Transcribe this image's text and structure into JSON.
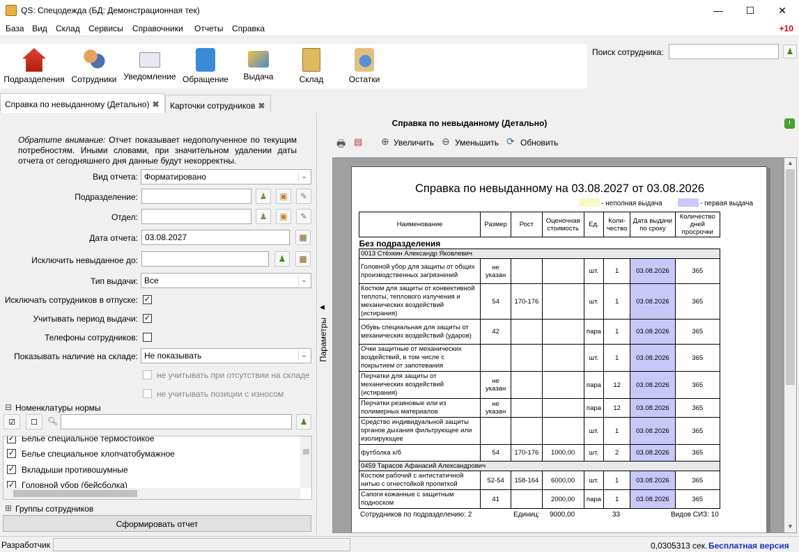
{
  "window": {
    "title": "QS: Спецодежда (БД: Демонстрационная тек)",
    "min": "—",
    "max": "☐",
    "close": "✕"
  },
  "menu": {
    "items": [
      "База",
      "Вид",
      "Склад",
      "Сервисы",
      "Справочники",
      "Отчеты",
      "Справка"
    ],
    "badge": "+10"
  },
  "toolbar": {
    "buttons": [
      "Подразделения",
      "Сотрудники",
      "Уведомление",
      "Обращение",
      "Выдача",
      "Склад",
      "Остатки"
    ]
  },
  "search": {
    "label": "Поиск сотрудника:",
    "value": ""
  },
  "tabs": [
    {
      "label": "Справка по невыданному (Детально)"
    },
    {
      "label": "Карточки сотрудников"
    }
  ],
  "params": {
    "note_em": "Обратите внимание:",
    "note": "Отчет показывает недополученное по текущим потребностям. Иными словами, при значительном удалении даты отчета от сегодняшнего дня данные будут некорректны.",
    "report_type_label": "Вид отчета:",
    "report_type_value": "Форматировано",
    "division_label": "Подразделение:",
    "division_value": "",
    "department_label": "Отдел:",
    "department_value": "",
    "report_date_label": "Дата отчета:",
    "report_date_value": "03.08.2027",
    "exclude_label": "Исключить невыданное до:",
    "exclude_value": "",
    "issue_type_label": "Тип выдачи:",
    "issue_type_value": "Все",
    "vacation_label": "Исключать сотрудников в отпуске:",
    "vacation_checked": "✓",
    "period_label": "Учитывать период выдачи:",
    "period_checked": "✓",
    "phones_label": "Телефоны сотрудников:",
    "phones_checked": "",
    "stock_label": "Показывать наличие на складе:",
    "stock_value": "Не показывать",
    "no_stock_label": "не учитывать при отсутствии на складе",
    "worn_label": "не учитывать позиции с износом",
    "nomenclature_header": "Номенклатуры нормы",
    "nomenclature_items": [
      "Белье специальное термостойкое",
      "Белье специальное хлопчатобумажное",
      "Вкладыши противошумные",
      "Головной убор (бейсболка)"
    ],
    "groups_header": "Группы сотрудников",
    "generate_button": "Сформировать отчет",
    "side_label": "Параметры"
  },
  "report": {
    "viewer_title": "Справка по невыданному (Детально)",
    "zoom_in": "Увеличить",
    "zoom_out": "Уменьшить",
    "refresh": "Обновить",
    "heading": "Справка по невыданному на 03.08.2027 от 03.08.2026",
    "legend_partial": "- неполная выдача",
    "legend_first": "- первая выдача",
    "columns": [
      "Наименование",
      "Размер",
      "Рост",
      "Оценочная стоимость",
      "Ед.",
      "Коли-чество",
      "Дата выдачи по сроку",
      "Количество дней просрочки"
    ],
    "group": "Без подразделения",
    "employees": [
      {
        "name": "0013  Стёхкин Александр Яковлевич",
        "rows": [
          [
            "Головной убор для защиты от общих производственных загрязнений",
            "не указан",
            "",
            "",
            "шт.",
            "1",
            "03.08.2026",
            "365"
          ],
          [
            "Костюм для защиты от конвективной теплоты, теплового излучения и механических воздействий (истирания)",
            "54",
            "170-176",
            "",
            "шт.",
            "1",
            "03.08.2026",
            "365"
          ],
          [
            "Обувь специальная для защиты от механических воздействий (ударов)",
            "42",
            "",
            "",
            "пара",
            "1",
            "03.08.2026",
            "365"
          ],
          [
            "Очки защитные от механических воздействий, в том числе с покрытием от запотевания",
            "",
            "",
            "",
            "шт.",
            "1",
            "03.08.2026",
            "365"
          ],
          [
            "Перчатки для защиты от механических воздействий (истирания)",
            "не указан",
            "",
            "",
            "пара",
            "12",
            "03.08.2026",
            "365"
          ],
          [
            "Перчатки резиновые или из полимерных материалов",
            "не указан",
            "",
            "",
            "пара",
            "12",
            "03.08.2026",
            "365"
          ],
          [
            "Средство индивидуальной защиты органов дыхания фильтрующее или изолирующее",
            "",
            "",
            "",
            "шт.",
            "1",
            "03.08.2026",
            "365"
          ],
          [
            "футболка х/б",
            "54",
            "170-176",
            "1000,00",
            "шт.",
            "2",
            "03.08.2026",
            "365"
          ]
        ]
      },
      {
        "name": "0459  Тарасов Афанасий Александрович",
        "rows": [
          [
            "Костюм рабочий с антистатичной нитью с огнестойкой пропиткой",
            "52-54",
            "158-164",
            "6000,00",
            "шт.",
            "1",
            "03.08.2026",
            "365"
          ],
          [
            "Сапоги кожанные с защитным подноском",
            "41",
            "",
            "2000,00",
            "пара",
            "1",
            "03.08.2026",
            "365"
          ]
        ]
      }
    ],
    "footer_employees": "Сотрудников по подразделению: 2",
    "footer_units": "Единиц:",
    "footer_cost": "9000,00",
    "footer_qty": "33",
    "footer_kinds": "Видов СИЗ: 10"
  },
  "status": {
    "user": "Разработчик",
    "time": "0,0305313 сек.",
    "version": "Бесплатная версия"
  }
}
